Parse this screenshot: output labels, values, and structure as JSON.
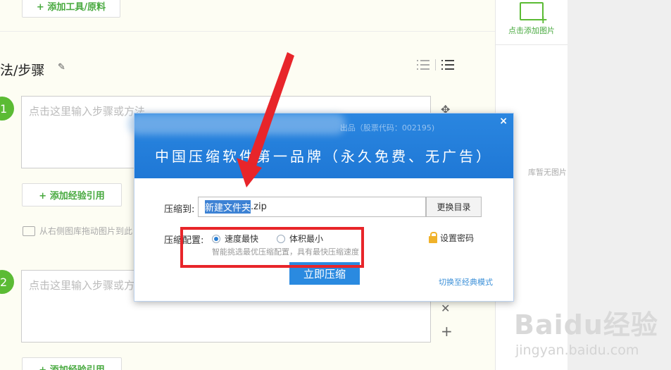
{
  "editor": {
    "add_tools": "+ 添加工具/原料",
    "steps_title": "法/步骤",
    "step1_number": "1",
    "step1_placeholder": "点击这里输入步骤或方法",
    "step2_number": "2",
    "step2_placeholder": "点击这里输入步骤或方法",
    "add_ref": "+ 添加经验引用",
    "add_ref_2": "+ 添加经验引用",
    "image_hint": "从右侧图库拖动图片到此"
  },
  "right_panel": {
    "add_image": "点击添加图片",
    "empty_gallery": "库暂无图片"
  },
  "dialog": {
    "subtitle": "出品（股票代码：002195)",
    "slogan": "中国压缩软件第一品牌（永久免费、无广告）",
    "compress_to_label": "压缩到:",
    "path_selected": "新建文件夹",
    "path_ext": ".zip",
    "change_dir": "更换目录",
    "config_label": "压缩配置:",
    "option_fast": "速度最快",
    "option_small": "体积最小",
    "selected_option": "速度最快",
    "hint": "智能挑选最优压缩配置，具有最快压缩速度",
    "set_password": "设置密码",
    "compress_now": "立即压缩",
    "switch_mode": "切换至经典模式",
    "close": "×"
  },
  "watermark": {
    "logo": "Baidu经验",
    "url": "jingyan.baidu.com"
  },
  "colors": {
    "accent_green": "#5bbb34",
    "dialog_blue": "#2a86e0",
    "highlight_red": "#e8252a"
  }
}
